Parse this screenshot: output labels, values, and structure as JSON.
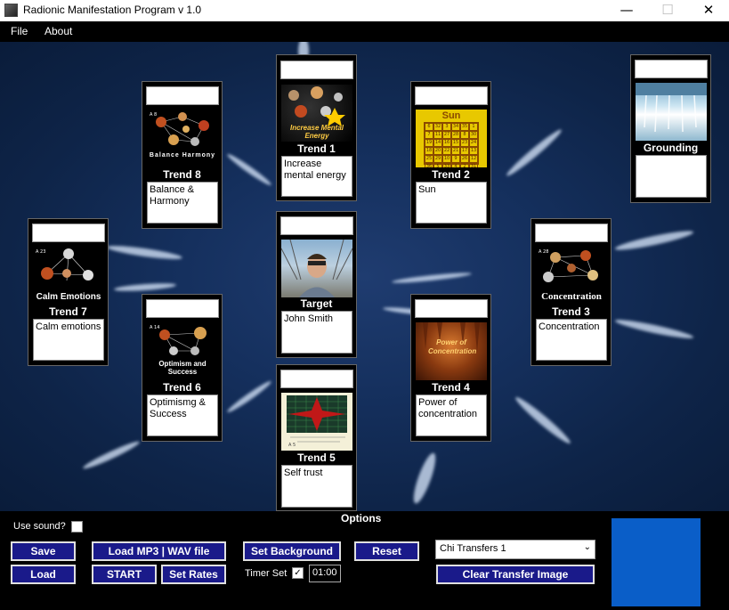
{
  "window": {
    "title": "Radionic Manifestation Program v 1.0",
    "minimize": "—",
    "maximize": "☐",
    "close": "✕"
  },
  "menu": {
    "file": "File",
    "about": "About"
  },
  "cards": {
    "trend1": {
      "label": "Trend 1",
      "text": "Increase mental energy",
      "image_caption": "Increase Mental Energy"
    },
    "trend2": {
      "label": "Trend 2",
      "text": "Sun",
      "image_caption": "Sun"
    },
    "trend3": {
      "label": "Trend 3",
      "text": "Concentration",
      "image_caption": "Concentration",
      "image_tag": "A 28"
    },
    "trend4": {
      "label": "Trend 4",
      "text": "Power of concentration",
      "image_caption": "Power of Concentration"
    },
    "trend5": {
      "label": "Trend 5",
      "text": "Self trust",
      "image_tag": "A 5"
    },
    "trend6": {
      "label": "Trend 6",
      "text": "Optimismg & Success",
      "image_caption": "Optimism and Success",
      "image_tag": "A 14"
    },
    "trend7": {
      "label": "Trend 7",
      "text": "Calm emotions",
      "image_caption": "Calm Emotions",
      "image_tag": "A 23"
    },
    "trend8": {
      "label": "Trend 8",
      "text": "Balance & Harmony",
      "image_caption": "Balance Harmony",
      "image_tag": "A 8"
    },
    "target": {
      "label": "Target",
      "text": "John Smith"
    },
    "grounding": {
      "label": "Grounding",
      "text": ""
    }
  },
  "sun_grid": [
    [
      "6",
      "32",
      "3",
      "34",
      "35",
      "1"
    ],
    [
      "7",
      "11",
      "27",
      "28",
      "8",
      "30"
    ],
    [
      "19",
      "14",
      "16",
      "15",
      "23",
      "24"
    ],
    [
      "18",
      "20",
      "22",
      "21",
      "17",
      "13"
    ],
    [
      "25",
      "29",
      "10",
      "9",
      "26",
      "12"
    ],
    [
      "36",
      "5",
      "33",
      "4",
      "2",
      "31"
    ]
  ],
  "bottom": {
    "options_title": "Options",
    "use_sound_label": "Use sound?",
    "save": "Save",
    "load": "Load",
    "load_mp3": "Load MP3 | WAV file",
    "start": "START",
    "set_rates": "Set Rates",
    "set_background": "Set Background",
    "reset": "Reset",
    "timer_label": "Timer Set",
    "timer_value": "01:00",
    "transfer_select": "Chi Transfers 1",
    "clear_transfer": "Clear Transfer Image",
    "preview_color": "#0a5ec8"
  },
  "colors": {
    "button_bg": "#1a1a8a",
    "canvas_bg": "#15305e"
  }
}
